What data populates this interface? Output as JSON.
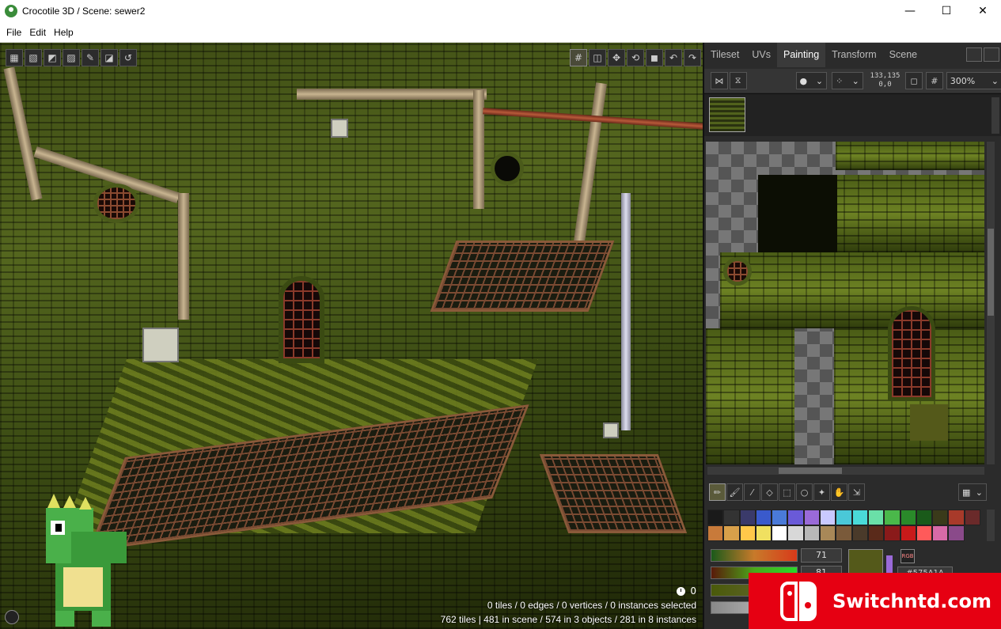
{
  "window": {
    "title": "Crocotile 3D / Scene: sewer2",
    "minimize_icon": "minimize-icon",
    "maximize_icon": "maximize-icon",
    "close_icon": "close-icon"
  },
  "menu": {
    "items": [
      "File",
      "Edit",
      "Help"
    ]
  },
  "viewport": {
    "left_tools": [
      "select-tile-icon",
      "select-edge-icon",
      "select-vertex-icon",
      "select-object-icon",
      "paint-tile-icon",
      "draw-tile-icon",
      "rotate-tile-icon"
    ],
    "right_tools": [
      "grid-icon",
      "camera-icon",
      "move-icon",
      "rotate-icon",
      "scale-icon",
      "undo-icon",
      "redo-icon"
    ],
    "stats_line1": "0 tiles / 0 edges / 0 vertices / 0 instances selected",
    "stats_line2": "762 tiles | 481 in scene / 574 in 3 objects / 281 in 8 instances",
    "timer_value": "0"
  },
  "panel": {
    "tabs": [
      "Tileset",
      "UVs",
      "Painting",
      "Transform",
      "Scene"
    ],
    "active_tab": "Painting",
    "coords_line1": "133,135",
    "coords_line2": "0,0",
    "zoom": "300%",
    "paint_tools": [
      "pencil-icon",
      "brush-icon",
      "eyedropper-icon",
      "fill-icon",
      "rect-select-icon",
      "lasso-icon",
      "magic-wand-icon",
      "hand-icon",
      "move-selection-icon"
    ],
    "palette_colors": [
      "#1a1a1a",
      "#333333",
      "#3a3a6a",
      "#3a5acc",
      "#4a7ad8",
      "#6a5ad8",
      "#9a6ad8",
      "#c9c9ff",
      "#4ac8d8",
      "#4adad8",
      "#6ae0a8",
      "#4ab84a",
      "#2a8a2a",
      "#1a5a1a",
      "#3a3a1a",
      "#a83a2a",
      "#6a2a2a",
      "#c87a3a",
      "#d8a04a",
      "#ffc84a",
      "#f0e060",
      "#ffffff",
      "#d8d8d8",
      "#b8b8b8",
      "#a88858",
      "#7a5a3a",
      "#4a3a2a",
      "#5a2a1a",
      "#8a1a1a",
      "#c81a1a",
      "#ff5a5a",
      "#d86aa8",
      "#8a4a8a"
    ],
    "slider_values": [
      "71",
      "81",
      ""
    ],
    "current_color": "#54591a",
    "rgb_label": "RGB",
    "hex_value": "#575A1A"
  },
  "watermark": {
    "text": "Switchntd.com"
  }
}
